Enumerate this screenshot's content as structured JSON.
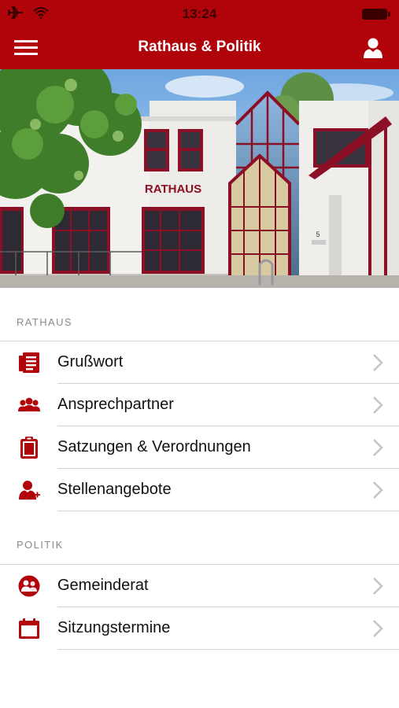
{
  "status_bar": {
    "time": "13:24",
    "icons": [
      "airplane-icon",
      "wifi-icon",
      "battery-icon"
    ]
  },
  "header": {
    "title": "Rathaus & Politik",
    "menu_icon": "hamburger-menu-icon",
    "user_icon": "user-profile-icon"
  },
  "hero": {
    "building_sign": "RATHAUS",
    "house_number": "5"
  },
  "colors": {
    "brand": "#b0030a",
    "icon": "#b0030a",
    "section_header": "#8a8a8a",
    "separator": "#d3d3d3"
  },
  "sections": [
    {
      "title": "RATHAUS",
      "items": [
        {
          "label": "Grußwort",
          "icon": "document-list-icon"
        },
        {
          "label": "Ansprechpartner",
          "icon": "people-group-icon"
        },
        {
          "label": "Satzungen & Verordnungen",
          "icon": "clipboard-icon"
        },
        {
          "label": "Stellenangebote",
          "icon": "user-add-icon"
        }
      ]
    },
    {
      "title": "POLITIK",
      "items": [
        {
          "label": "Gemeinderat",
          "icon": "council-group-icon"
        },
        {
          "label": "Sitzungstermine",
          "icon": "calendar-icon"
        }
      ]
    }
  ]
}
